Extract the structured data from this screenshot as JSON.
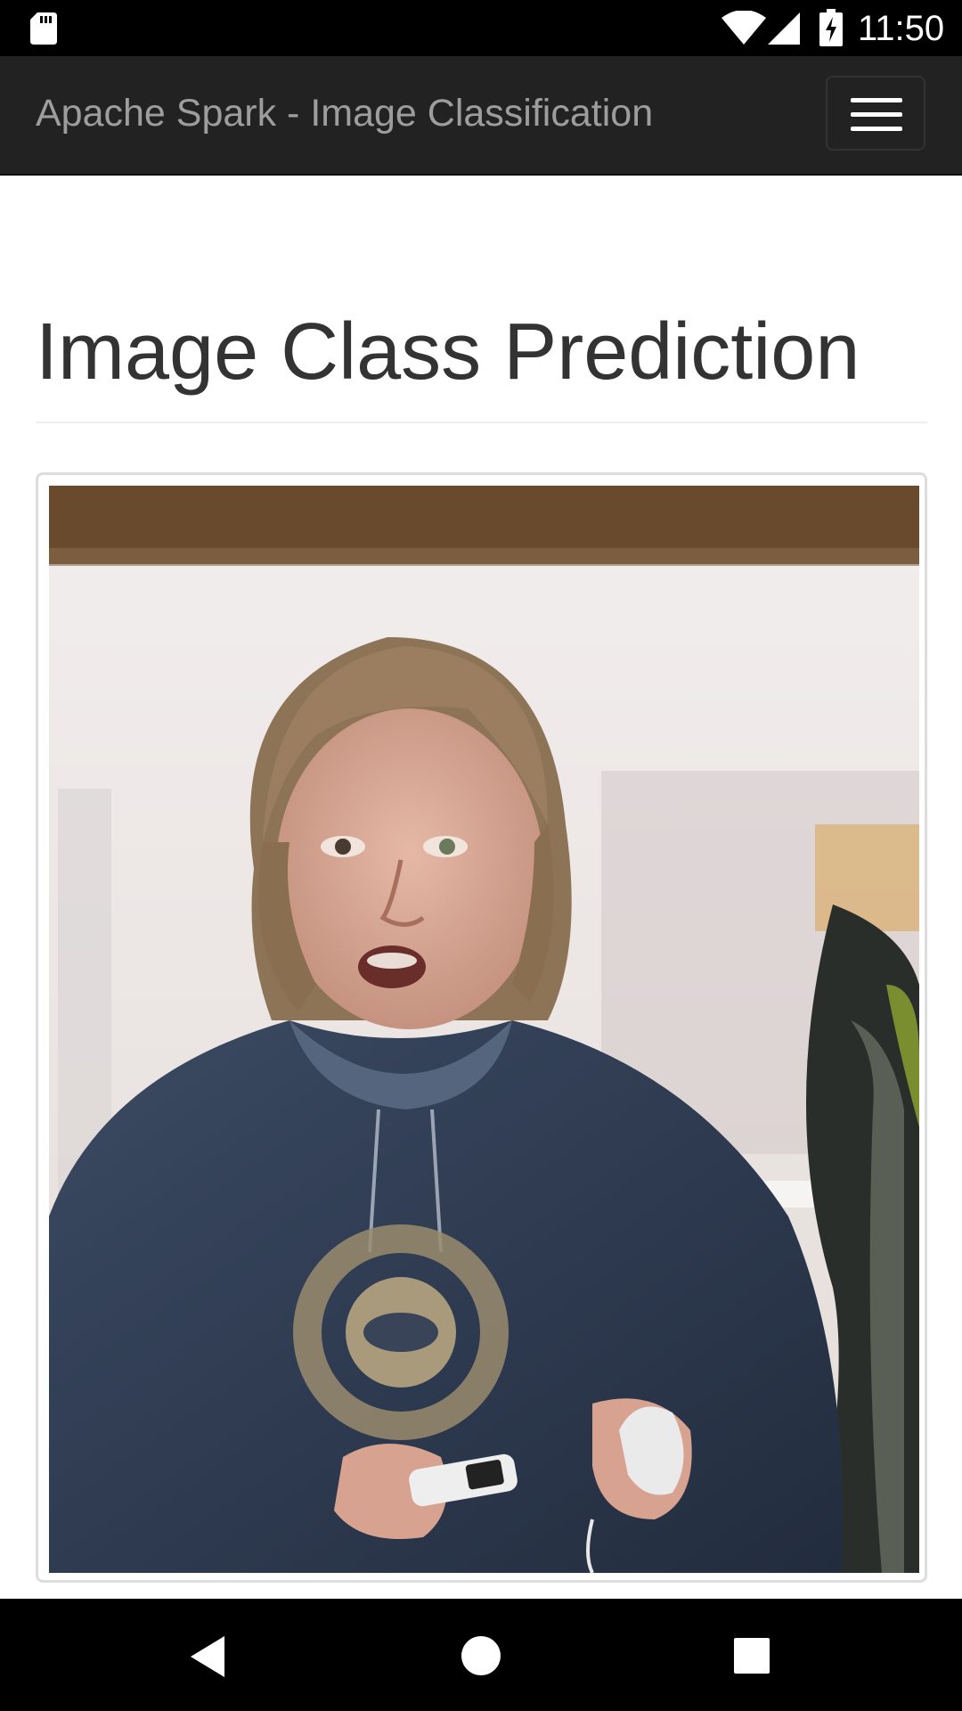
{
  "status_bar": {
    "time": "11:50",
    "icons": [
      "sd-card-icon",
      "wifi-icon",
      "signal-icon",
      "battery-charging-icon"
    ]
  },
  "navbar": {
    "brand": "Apache Spark - Image Classification",
    "menu_icon": "hamburger-menu-icon"
  },
  "main": {
    "title": "Image Class Prediction",
    "image": {
      "subject": "photo"
    }
  },
  "system_nav": {
    "icons": [
      "back-icon",
      "home-icon",
      "recents-icon"
    ]
  },
  "colors": {
    "status_bar_bg": "#000000",
    "navbar_bg": "#222222",
    "navbar_brand": "#9d9d9d",
    "title_text": "#333333",
    "thumbnail_border": "#dddddd"
  }
}
